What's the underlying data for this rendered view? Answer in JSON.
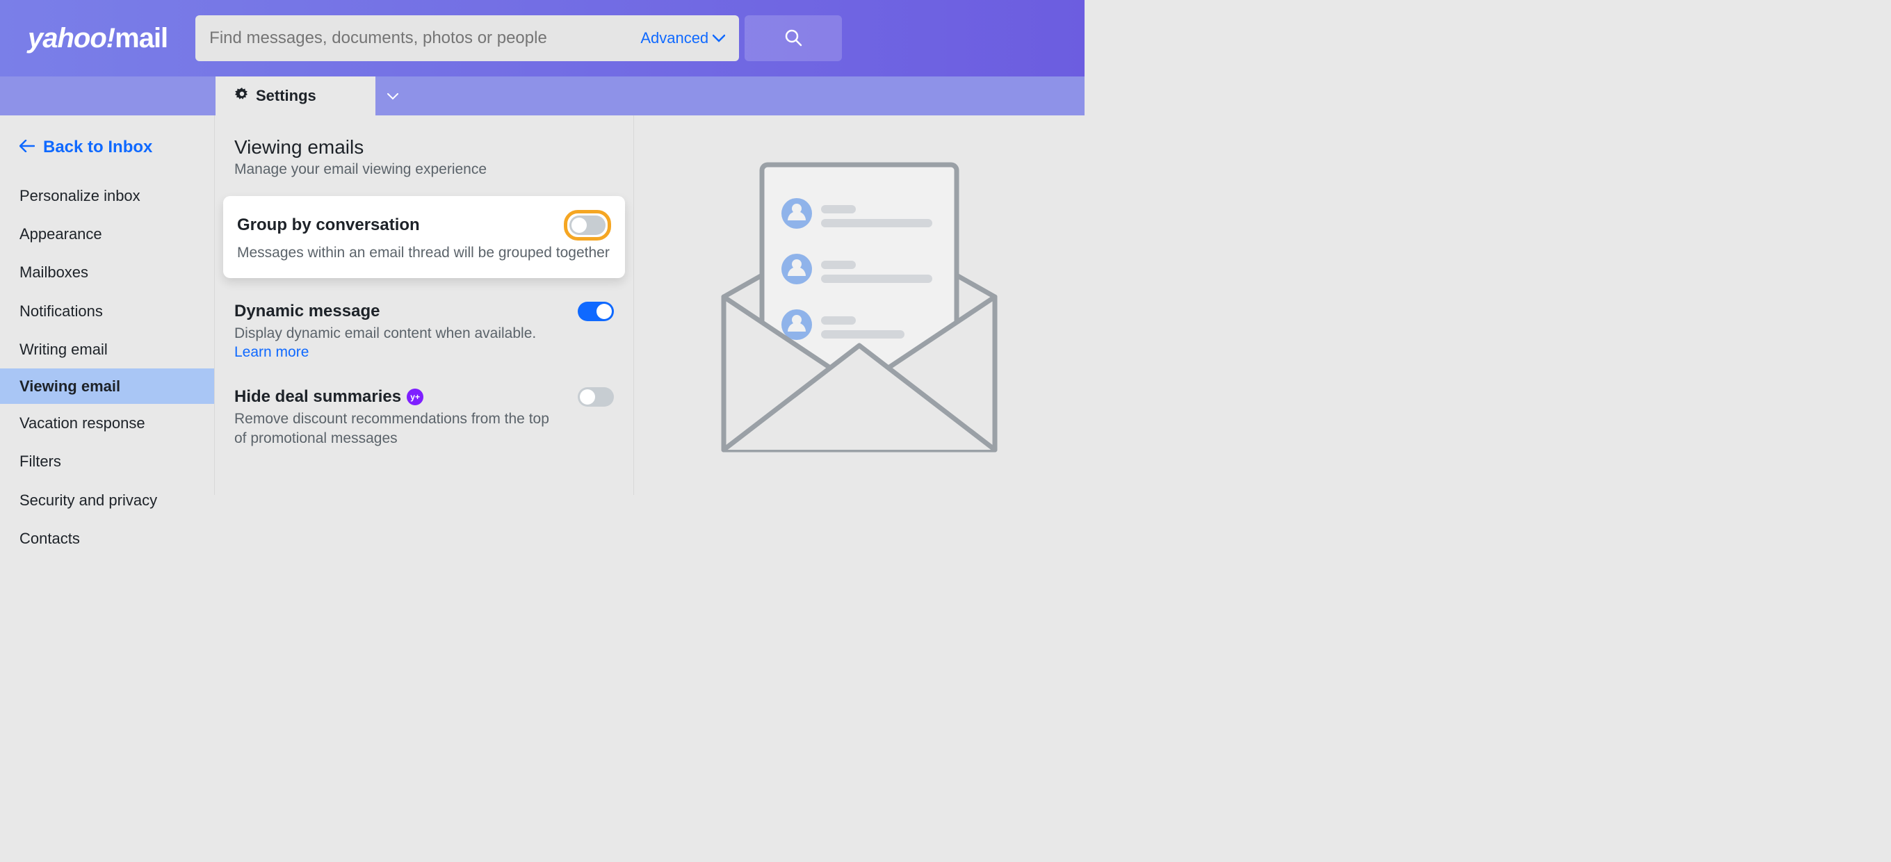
{
  "header": {
    "logo_brand": "yahoo!",
    "logo_product": "mail",
    "search_placeholder": "Find messages, documents, photos or people",
    "advanced_label": "Advanced"
  },
  "subheader": {
    "tab_label": "Settings"
  },
  "sidebar": {
    "back_label": "Back to Inbox",
    "items": [
      {
        "label": "Personalize inbox",
        "active": false
      },
      {
        "label": "Appearance",
        "active": false
      },
      {
        "label": "Mailboxes",
        "active": false
      },
      {
        "label": "Notifications",
        "active": false
      },
      {
        "label": "Writing email",
        "active": false
      },
      {
        "label": "Viewing email",
        "active": true
      },
      {
        "label": "Vacation response",
        "active": false
      },
      {
        "label": "Filters",
        "active": false
      },
      {
        "label": "Security and privacy",
        "active": false
      },
      {
        "label": "Contacts",
        "active": false
      }
    ]
  },
  "panel": {
    "section_title": "Viewing emails",
    "section_subtitle": "Manage your email viewing experience",
    "settings": [
      {
        "title": "Group by conversation",
        "desc": "Messages within an email thread will be grouped together",
        "toggle": "off",
        "highlighted": true
      },
      {
        "title": "Dynamic message",
        "desc": "Display dynamic email content when available.",
        "learn_more": "Learn more",
        "toggle": "on"
      },
      {
        "title": "Hide deal summaries",
        "badge": "y+",
        "desc": "Remove discount recommendations from the top of promotional messages",
        "toggle": "off"
      }
    ]
  },
  "colors": {
    "accent_blue": "#0f69ff",
    "header_gradient_start": "#7a7fe8",
    "header_gradient_end": "#6c5de0",
    "highlight_orange": "#f5a623",
    "plus_purple": "#7e1fff",
    "sidebar_active": "#a9c6f5"
  }
}
